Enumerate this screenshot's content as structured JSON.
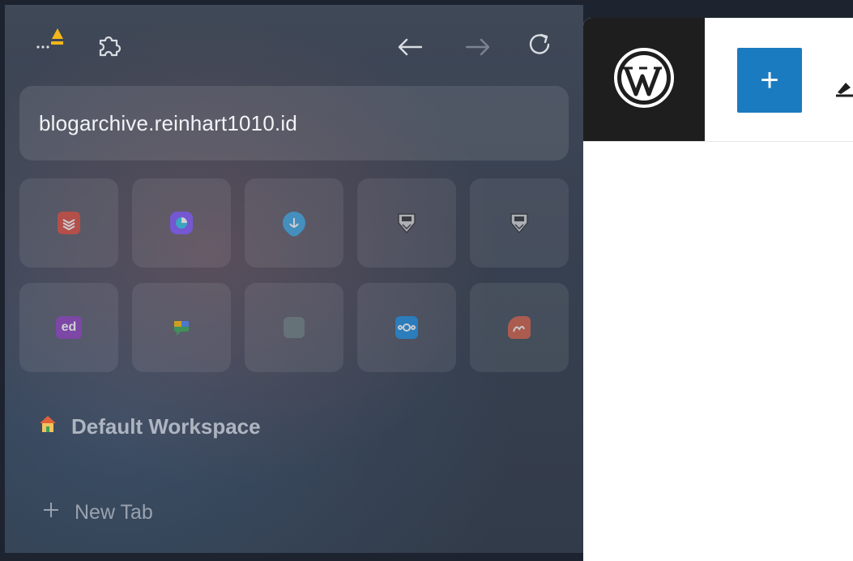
{
  "browser": {
    "url_text": "blogarchive.reinhart1010.id",
    "icons": {
      "alert": "alert-triangle-icon",
      "extensions": "puzzle-icon",
      "back": "arrow-left-icon",
      "forward": "arrow-right-icon",
      "reload": "reload-icon"
    },
    "pinned_tabs": [
      {
        "name": "todoist-tab",
        "icon": "todoist-icon",
        "color": "#db4c3f"
      },
      {
        "name": "analytics-tab",
        "icon": "pie-chart-icon",
        "color": "#7d57ff"
      },
      {
        "name": "anchor-tab",
        "icon": "anchor-icon",
        "color": "#3aa7e3"
      },
      {
        "name": "campus-tab-1",
        "icon": "shield-crest-icon",
        "color": "#d4d7db"
      },
      {
        "name": "campus-tab-2",
        "icon": "shield-crest-icon",
        "color": "#d4d7db"
      },
      {
        "name": "ed-tab",
        "icon": "ed-icon",
        "label": "ed",
        "color": "#8e3fbf"
      },
      {
        "name": "chat-tab",
        "icon": "chat-icon",
        "color": "#34a853"
      },
      {
        "name": "blank-tab",
        "icon": "blank-square-icon",
        "color": "#6b7d80"
      },
      {
        "name": "nextcloud-tab",
        "icon": "nextcloud-icon",
        "color": "#1d8fe3"
      },
      {
        "name": "sway-tab",
        "icon": "scribble-icon",
        "color": "#d7624a"
      }
    ],
    "workspace": {
      "icon": "house-icon",
      "label": "Default Workspace"
    },
    "new_tab": {
      "icon": "plus-icon",
      "label": "New Tab"
    }
  },
  "page": {
    "header": {
      "logo": "wordpress-logo-icon",
      "add_label": "+",
      "edit_icon": "pen-icon"
    }
  }
}
